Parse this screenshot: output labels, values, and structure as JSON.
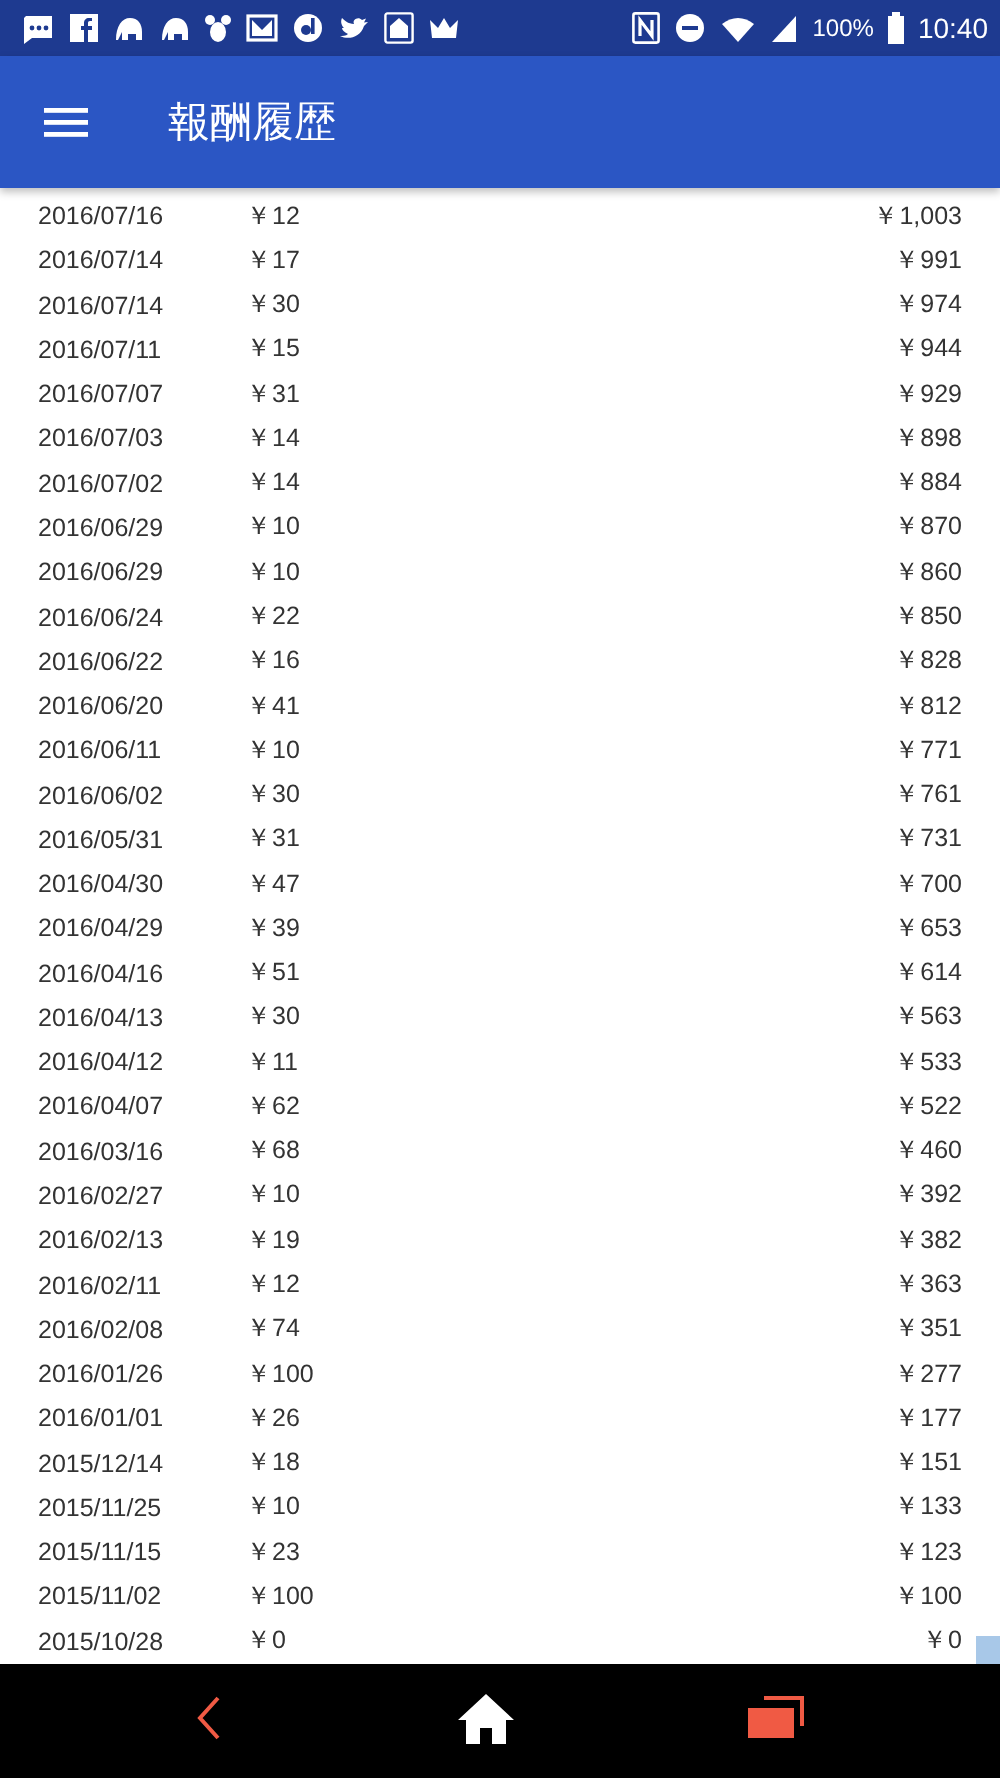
{
  "status_bar": {
    "battery": "100%",
    "time": "10:40"
  },
  "app_bar": {
    "title": "報酬履歴"
  },
  "rows": [
    {
      "date": "2016/07/16",
      "amount": "￥12",
      "total": "￥1,003"
    },
    {
      "date": "2016/07/14",
      "amount": "￥17",
      "total": "￥991"
    },
    {
      "date": "2016/07/14",
      "amount": "￥30",
      "total": "￥974"
    },
    {
      "date": "2016/07/11",
      "amount": "￥15",
      "total": "￥944"
    },
    {
      "date": "2016/07/07",
      "amount": "￥31",
      "total": "￥929"
    },
    {
      "date": "2016/07/03",
      "amount": "￥14",
      "total": "￥898"
    },
    {
      "date": "2016/07/02",
      "amount": "￥14",
      "total": "￥884"
    },
    {
      "date": "2016/06/29",
      "amount": "￥10",
      "total": "￥870"
    },
    {
      "date": "2016/06/29",
      "amount": "￥10",
      "total": "￥860"
    },
    {
      "date": "2016/06/24",
      "amount": "￥22",
      "total": "￥850"
    },
    {
      "date": "2016/06/22",
      "amount": "￥16",
      "total": "￥828"
    },
    {
      "date": "2016/06/20",
      "amount": "￥41",
      "total": "￥812"
    },
    {
      "date": "2016/06/11",
      "amount": "￥10",
      "total": "￥771"
    },
    {
      "date": "2016/06/02",
      "amount": "￥30",
      "total": "￥761"
    },
    {
      "date": "2016/05/31",
      "amount": "￥31",
      "total": "￥731"
    },
    {
      "date": "2016/04/30",
      "amount": "￥47",
      "total": "￥700"
    },
    {
      "date": "2016/04/29",
      "amount": "￥39",
      "total": "￥653"
    },
    {
      "date": "2016/04/16",
      "amount": "￥51",
      "total": "￥614"
    },
    {
      "date": "2016/04/13",
      "amount": "￥30",
      "total": "￥563"
    },
    {
      "date": "2016/04/12",
      "amount": "￥11",
      "total": "￥533"
    },
    {
      "date": "2016/04/07",
      "amount": "￥62",
      "total": "￥522"
    },
    {
      "date": "2016/03/16",
      "amount": "￥68",
      "total": "￥460"
    },
    {
      "date": "2016/02/27",
      "amount": "￥10",
      "total": "￥392"
    },
    {
      "date": "2016/02/13",
      "amount": "￥19",
      "total": "￥382"
    },
    {
      "date": "2016/02/11",
      "amount": "￥12",
      "total": "￥363"
    },
    {
      "date": "2016/02/08",
      "amount": "￥74",
      "total": "￥351"
    },
    {
      "date": "2016/01/26",
      "amount": "￥100",
      "total": "￥277"
    },
    {
      "date": "2016/01/01",
      "amount": "￥26",
      "total": "￥177"
    },
    {
      "date": "2015/12/14",
      "amount": "￥18",
      "total": "￥151"
    },
    {
      "date": "2015/11/25",
      "amount": "￥10",
      "total": "￥133"
    },
    {
      "date": "2015/11/15",
      "amount": "￥23",
      "total": "￥123"
    },
    {
      "date": "2015/11/02",
      "amount": "￥100",
      "total": "￥100"
    },
    {
      "date": "2015/10/28",
      "amount": "￥0",
      "total": "￥0"
    }
  ]
}
